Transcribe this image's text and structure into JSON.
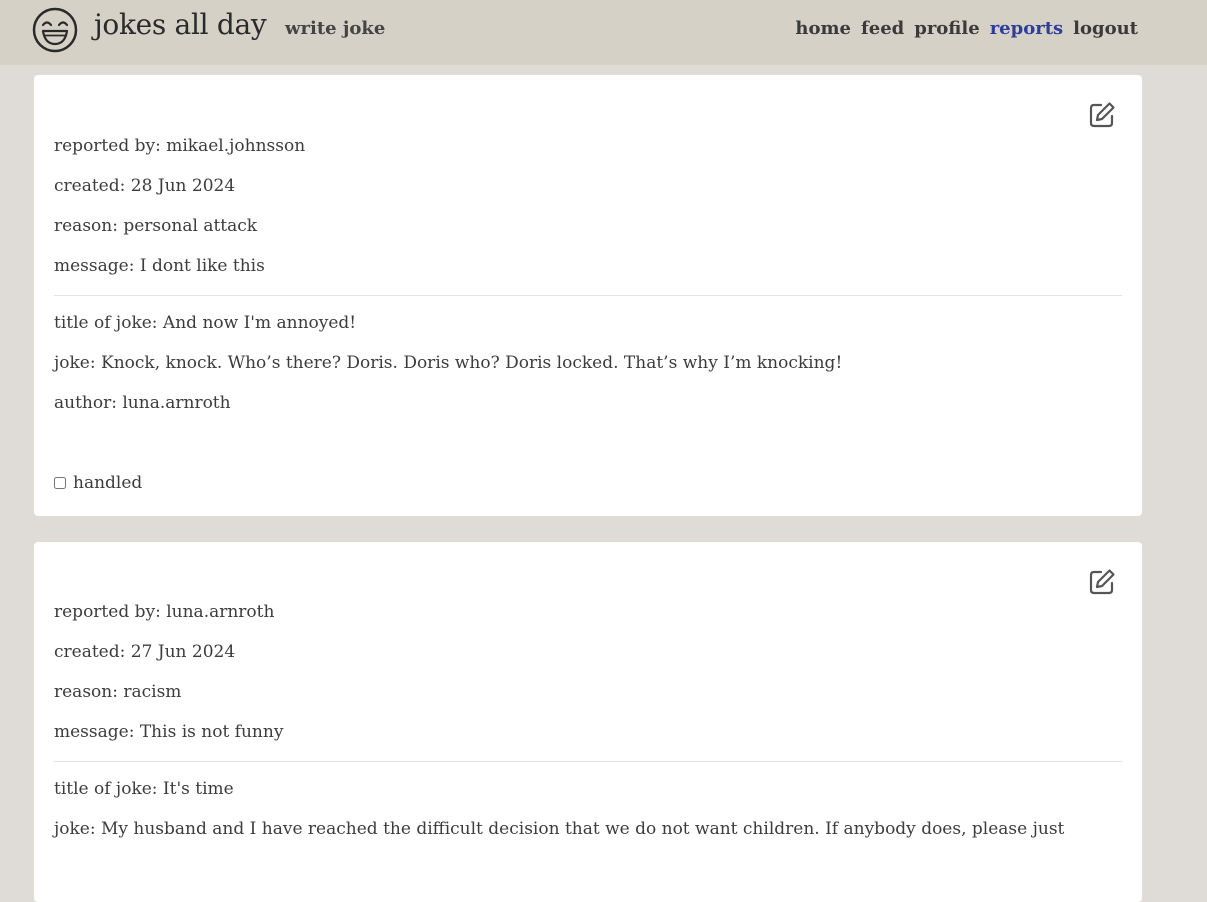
{
  "header": {
    "brand": "jokes all day",
    "write_link": "write joke",
    "nav": {
      "home": "home",
      "feed": "feed",
      "profile": "profile",
      "reports": "reports",
      "logout": "logout"
    },
    "active_nav": "reports",
    "colors": {
      "bar": "#d6d1c6",
      "active_link": "#2e3d9a",
      "page_bg": "#dfdbd7"
    }
  },
  "reports": [
    {
      "reported_by": "reported by: mikael.johnsson",
      "created": "created: 28 Jun 2024",
      "reason": "reason: personal attack",
      "message": "message: I dont like this",
      "joke_title": "title of joke: And now I'm annoyed!",
      "joke": "joke: Knock, knock. Who’s there? Doris. Doris who? Doris locked. That’s why I’m knocking!",
      "author": "author: luna.arnroth",
      "handled_label": "handled",
      "handled": false
    },
    {
      "reported_by": "reported by: luna.arnroth",
      "created": "created: 27 Jun 2024",
      "reason": "reason: racism",
      "message": "message: This is not funny",
      "joke_title": "title of joke: It's time",
      "joke": "joke: My husband and I have reached the difficult decision that we do not want children. If anybody does, please just"
    }
  ],
  "icons": {
    "logo": "laughing-face-icon",
    "edit": "edit-pencil-square-icon"
  }
}
